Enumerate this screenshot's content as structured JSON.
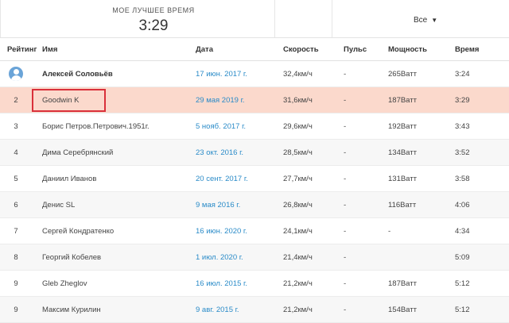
{
  "best": {
    "label": "Мое лучшее время",
    "time": "3:29"
  },
  "filter": {
    "label": "Все"
  },
  "columns": {
    "rank": "Рейтинг",
    "name": "Имя",
    "date": "Дата",
    "speed": "Скорость",
    "pulse": "Пульс",
    "power": "Мощность",
    "time": "Время"
  },
  "rows": [
    {
      "rank": "",
      "name": "Алексей Соловьёв",
      "date": "17 июн. 2017 г.",
      "speed": "32,4км/ч",
      "pulse": "-",
      "power": "265Ватт",
      "time": "3:24"
    },
    {
      "rank": "2",
      "name": "Goodwin K",
      "date": "29 мая 2019 г.",
      "speed": "31,6км/ч",
      "pulse": "-",
      "power": "187Ватт",
      "time": "3:29"
    },
    {
      "rank": "3",
      "name": "Борис Петров.Петрович.1951г.",
      "date": "5 нояб. 2017 г.",
      "speed": "29,6км/ч",
      "pulse": "-",
      "power": "192Ватт",
      "time": "3:43"
    },
    {
      "rank": "4",
      "name": "Дима Серебрянский",
      "date": "23 окт. 2016 г.",
      "speed": "28,5км/ч",
      "pulse": "-",
      "power": "134Ватт",
      "time": "3:52"
    },
    {
      "rank": "5",
      "name": "Даниил Иванов",
      "date": "20 сент. 2017 г.",
      "speed": "27,7км/ч",
      "pulse": "-",
      "power": "131Ватт",
      "time": "3:58"
    },
    {
      "rank": "6",
      "name": "Денис SL",
      "date": "9 мая 2016 г.",
      "speed": "26,8км/ч",
      "pulse": "-",
      "power": "116Ватт",
      "time": "4:06"
    },
    {
      "rank": "7",
      "name": "Сергей Кондратенко",
      "date": "16 июн. 2020 г.",
      "speed": "24,1км/ч",
      "pulse": "-",
      "power": "-",
      "time": "4:34"
    },
    {
      "rank": "8",
      "name": "Георгий Кобелев",
      "date": "1 июл. 2020 г.",
      "speed": "21,4км/ч",
      "pulse": "-",
      "power": "",
      "time": "5:09"
    },
    {
      "rank": "9",
      "name": "Gleb Zheglov",
      "date": "16 июл. 2015 г.",
      "speed": "21,2км/ч",
      "pulse": "-",
      "power": "187Ватт",
      "time": "5:12"
    },
    {
      "rank": "9",
      "name": "Максим Курилин",
      "date": "9 авг. 2015 г.",
      "speed": "21,2км/ч",
      "pulse": "-",
      "power": "154Ватт",
      "time": "5:12"
    }
  ]
}
